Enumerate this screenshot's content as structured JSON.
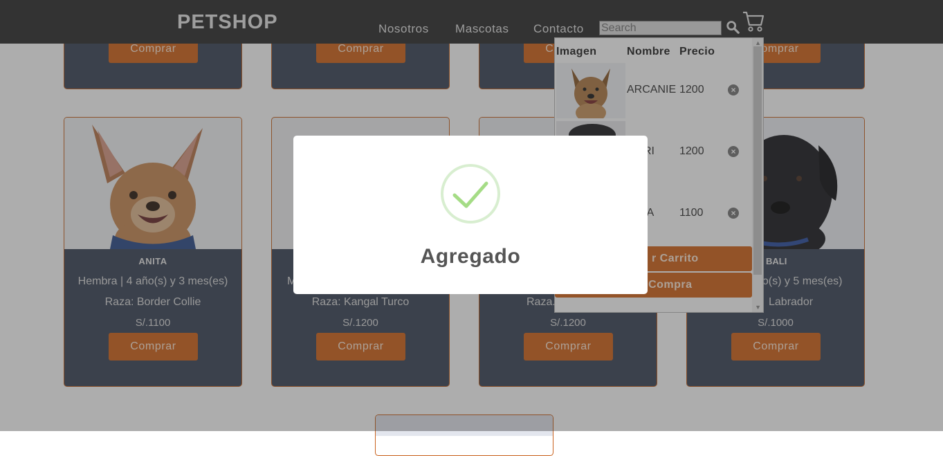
{
  "header": {
    "logo": "PETSHOP",
    "nav": [
      "Nosotros",
      "Mascotas",
      "Contacto"
    ],
    "search_placeholder": "Search"
  },
  "top_row": {
    "buy_label": "Comprar"
  },
  "cards": [
    {
      "name": "ANITA",
      "info": "Hembra | 4 año(s) y 3 mes(es)",
      "breed": "Raza: Border Collie",
      "price": "S/.1100",
      "buy_label": "Comprar"
    },
    {
      "name": "",
      "info": "M",
      "breed": "Raza: Kangal Turco",
      "price": "S/.1200",
      "buy_label": "Comprar"
    },
    {
      "name": "",
      "info": "",
      "breed": "Raza.",
      "price": "S/.1200",
      "buy_label": "Comprar"
    },
    {
      "name": "BALI",
      "info": "ño(s) y 5 mes(es)",
      "breed": "Labrador",
      "price": "S/.1000",
      "buy_label": "Comprar"
    }
  ],
  "cart": {
    "headers": [
      "Imagen",
      "Nombre",
      "Precio"
    ],
    "items": [
      {
        "name": "ARCANIE",
        "price": "1200"
      },
      {
        "name": "RI",
        "price": "1200"
      },
      {
        "name": "TA",
        "price": "1100"
      }
    ],
    "empty_label": "r Carrito",
    "checkout_label": "ar Compra"
  },
  "modal": {
    "title": "Agregado"
  },
  "colors": {
    "accent": "#d2651a",
    "card_bg": "#3b4558",
    "header_bg": "#2e2e2e",
    "success": "#a5dc86"
  }
}
